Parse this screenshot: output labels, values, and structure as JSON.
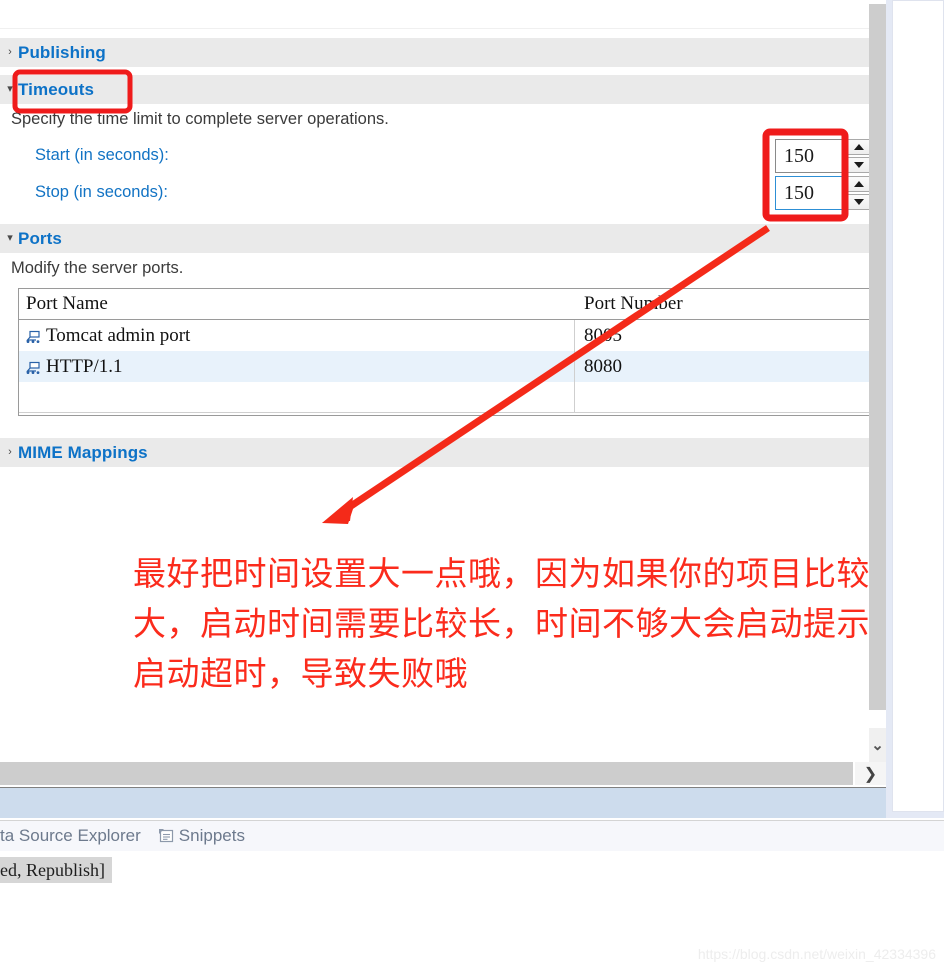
{
  "sections": {
    "publishing": {
      "title": "Publishing",
      "twisty": "›"
    },
    "timeouts": {
      "title": "Timeouts",
      "twisty": "▾",
      "description": "Specify the time limit to complete server operations.",
      "fields": [
        {
          "label": "Start (in seconds):",
          "value": "150",
          "focused": false
        },
        {
          "label": "Stop (in seconds):",
          "value": "150",
          "focused": true
        }
      ]
    },
    "ports": {
      "title": "Ports",
      "twisty": "▾",
      "description": "Modify the server ports.",
      "table": {
        "columns": [
          "Port Name",
          "Port Number"
        ],
        "rows": [
          {
            "name": "Tomcat admin port",
            "number": "8005",
            "selected": false
          },
          {
            "name": "HTTP/1.1",
            "number": "8080",
            "selected": true
          }
        ]
      }
    },
    "mime": {
      "title": "MIME Mappings",
      "twisty": "›"
    }
  },
  "annotation": {
    "line1": "最好把时间设置大一点哦，因为如果你的项目比较",
    "line2": "大，启动时间需要比较长，时间不够大会启动提示",
    "line3": "启动超时，导致失败哦",
    "color": "#fb2b1c"
  },
  "scrollbars": {
    "vertical_down_chevron": "⌄",
    "horizontal_right_chevron": "❯"
  },
  "bottom_tabs": [
    {
      "label": "ta Source Explorer",
      "icon": ""
    },
    {
      "label": "Snippets",
      "icon": "snippets-icon"
    }
  ],
  "status": {
    "text": "ed, Republish]"
  },
  "watermark": {
    "text": "https://blog.csdn.net/weixin_42334396"
  },
  "colors": {
    "section_link": "#0d72c7",
    "field_label": "#1273c4",
    "highlight_red": "#fb2b1c",
    "selected_row": "#e8f2fb"
  }
}
